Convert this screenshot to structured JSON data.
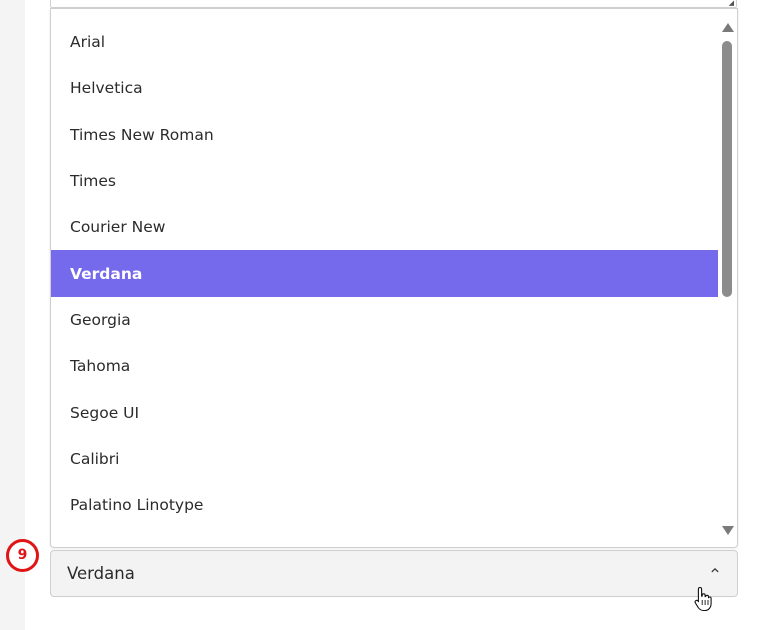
{
  "font_dropdown": {
    "options": [
      "Arial",
      "Helvetica",
      "Times New Roman",
      "Times",
      "Courier New",
      "Verdana",
      "Georgia",
      "Tahoma",
      "Segoe UI",
      "Calibri",
      "Palatino Linotype"
    ],
    "selected_index": 5,
    "highlight_color": "#7569ec"
  },
  "select": {
    "value": "Verdana"
  },
  "step_badge": {
    "label": "9",
    "color": "#e01414"
  },
  "icons": {
    "chevron": "chevron-up-icon",
    "scroll_up": "scroll-up-arrow-icon",
    "scroll_down": "scroll-down-arrow-icon",
    "cursor": "hand-pointer-cursor-icon"
  }
}
